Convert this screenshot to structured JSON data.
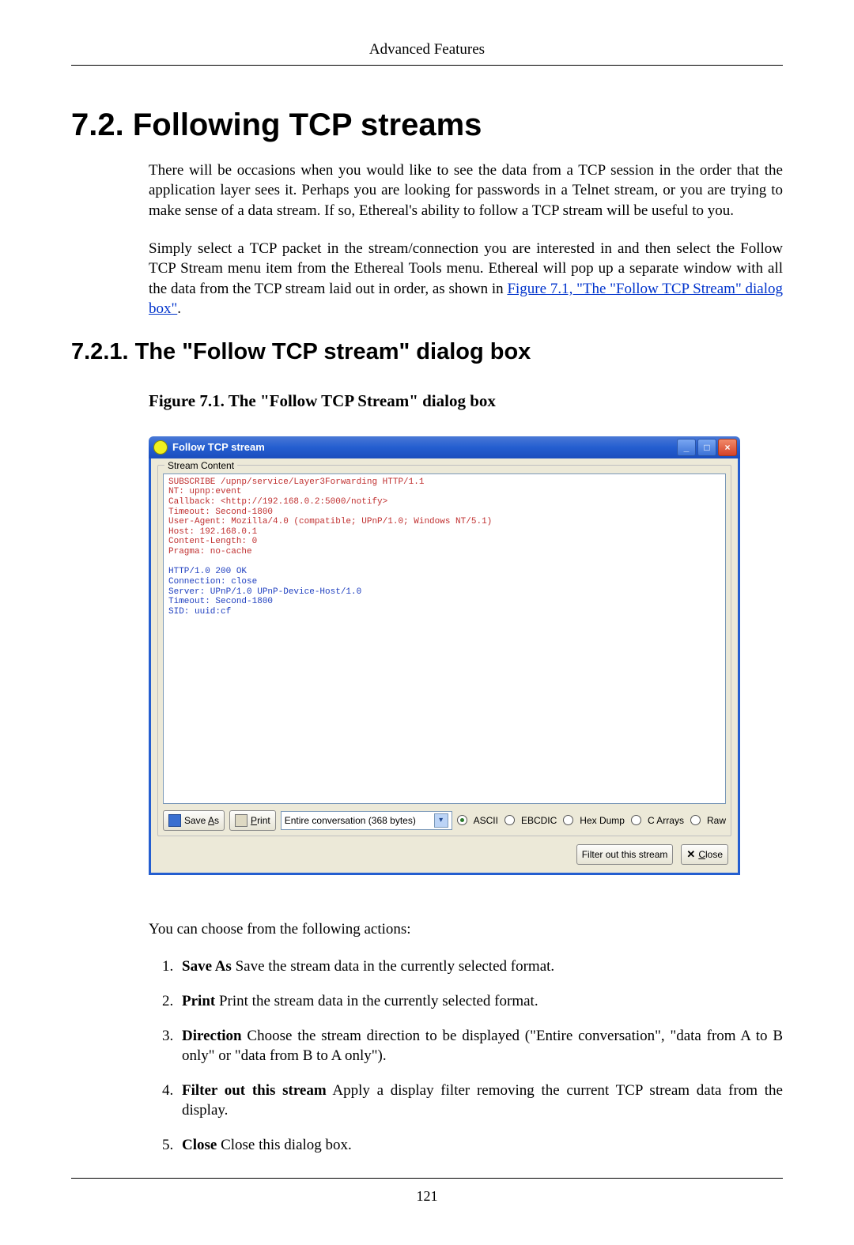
{
  "page": {
    "running_head": "Advanced Features",
    "h1": "7.2. Following TCP streams",
    "para1": "There will be occasions when you would like to see the data from a TCP session in the order that the application layer sees it. Perhaps you are looking for passwords in a Telnet stream, or you are trying to make sense of a data stream. If so, Ethereal's ability to follow a TCP stream will be useful to you.",
    "para2_a": "Simply select a TCP packet in the stream/connection you are interested in and then select the Follow TCP Stream menu item from the Ethereal Tools menu. Ethereal will pop up a separate window with all the data from the TCP stream laid out in order, as shown in ",
    "para2_link": "Figure 7.1, \"The \"Follow TCP Stream\" dialog box\"",
    "para2_b": ".",
    "h2": "7.2.1. The \"Follow TCP stream\" dialog box",
    "fig_caption": "Figure 7.1. The \"Follow TCP Stream\" dialog box",
    "after_fig": "You can choose from the following actions:",
    "actions": {
      "i1_b": "Save As",
      "i1_t": " Save the stream data in the currently selected format.",
      "i2_b": "Print",
      "i2_t": " Print the stream data in the currently selected format.",
      "i3_b": "Direction",
      "i3_t": " Choose the stream direction to be displayed (\"Entire conversation\", \"data from A to B only\" or \"data from B to A only\").",
      "i4_b": "Filter out this stream",
      "i4_t": " Apply a display filter removing the current TCP stream data from the display.",
      "i5_b": "Close",
      "i5_t": " Close this dialog box."
    },
    "page_number": "121"
  },
  "dialog": {
    "title": "Follow TCP stream",
    "group_legend": "Stream Content",
    "request": "SUBSCRIBE /upnp/service/Layer3Forwarding HTTP/1.1\nNT: upnp:event\nCallback: <http://192.168.0.2:5000/notify>\nTimeout: Second-1800\nUser-Agent: Mozilla/4.0 (compatible; UPnP/1.0; Windows NT/5.1)\nHost: 192.168.0.1\nContent-Length: 0\nPragma: no-cache\n",
    "response": "HTTP/1.0 200 OK\nConnection: close\nServer: UPnP/1.0 UPnP-Device-Host/1.0\nTimeout: Second-1800\nSID: uuid:cf",
    "save_as_pre": "Save ",
    "save_as_u": "A",
    "save_as_post": "s",
    "print_u": "P",
    "print_post": "rint",
    "combo_value": "Entire conversation (368 bytes)",
    "radios": {
      "ascii": "ASCII",
      "ebcdic": "EBCDIC",
      "hex": "Hex Dump",
      "carr": "C Arrays",
      "raw": "Raw"
    },
    "filter_out": "Filter out this stream",
    "close_u": "C",
    "close_post": "lose"
  }
}
